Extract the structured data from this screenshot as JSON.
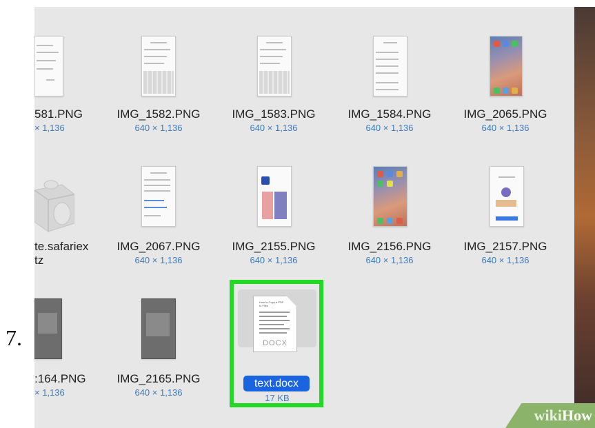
{
  "step": {
    "number": "7."
  },
  "files": [
    {
      "name": "581.PNG",
      "size": "× 1,136",
      "thumb": "iphone-form"
    },
    {
      "name": "IMG_1582.PNG",
      "size": "640 × 1,136",
      "thumb": "iphone-keyboard"
    },
    {
      "name": "IMG_1583.PNG",
      "size": "640 × 1,136",
      "thumb": "iphone-keyboard"
    },
    {
      "name": "IMG_1584.PNG",
      "size": "640 × 1,136",
      "thumb": "iphone-settings"
    },
    {
      "name": "IMG_2065.PNG",
      "size": "640 × 1,136",
      "thumb": "iphone-home"
    },
    {
      "name": "te.safariex",
      "name2": "tz",
      "size": "",
      "thumb": "extension-lego"
    },
    {
      "name": "IMG_2067.PNG",
      "size": "640 × 1,136",
      "thumb": "iphone-share"
    },
    {
      "name": "IMG_2155.PNG",
      "size": "640 × 1,136",
      "thumb": "iphone-app"
    },
    {
      "name": "IMG_2156.PNG",
      "size": "640 × 1,136",
      "thumb": "iphone-home"
    },
    {
      "name": "IMG_2157.PNG",
      "size": "640 × 1,136",
      "thumb": "iphone-onboarding"
    },
    {
      "name": ":164.PNG",
      "size": "× 1,136",
      "thumb": "iphone-dark"
    },
    {
      "name": "IMG_2165.PNG",
      "size": "640 × 1,136",
      "thumb": "iphone-dark"
    }
  ],
  "selected_file": {
    "name": "text.docx",
    "size": "17 KB",
    "icon_label": "DOCX",
    "doc_title": "How to Copy a PDF to Files"
  },
  "watermark": {
    "part1": "wiki",
    "part2": "How"
  },
  "colors": {
    "highlight": "#24d826",
    "selection": "#1a64e0",
    "size_text": "#3d7ab8"
  }
}
